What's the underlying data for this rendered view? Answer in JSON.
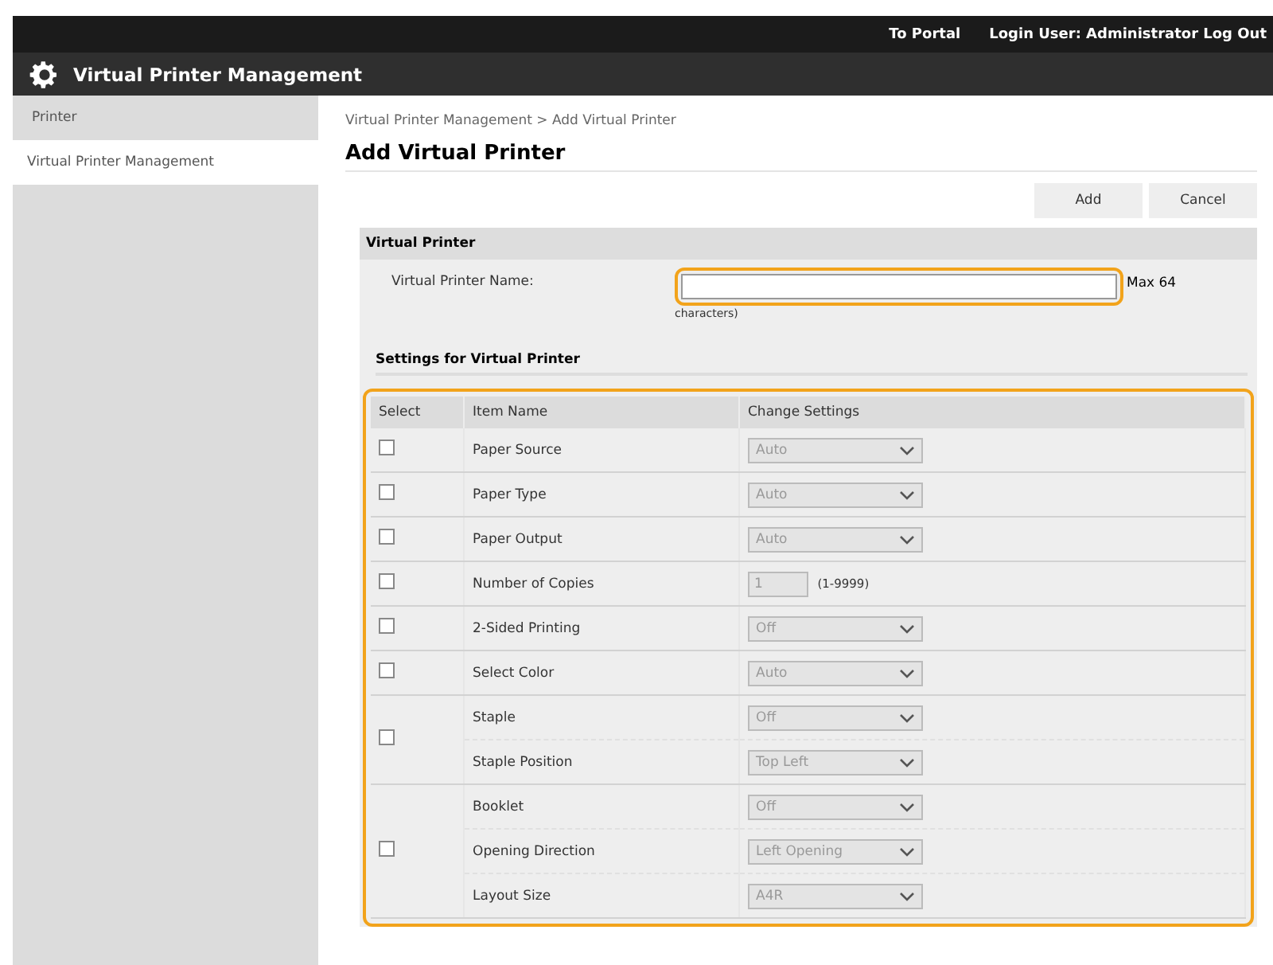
{
  "top_bar": {
    "links": [
      "To Portal",
      "Login User: Administrator Log Out"
    ]
  },
  "header": {
    "title": "Virtual Printer Management"
  },
  "sidebar": {
    "items": [
      {
        "label": "Printer",
        "selected": false
      },
      {
        "label": "Virtual Printer Management",
        "selected": true
      }
    ]
  },
  "breadcrumb": "Virtual Printer Management > Add Virtual Printer",
  "page_title": "Add Virtual Printer",
  "buttons": [
    "Add",
    "Cancel"
  ],
  "section": {
    "title": "Virtual Printer",
    "field_label": "Virtual Printer Name:",
    "hint": [
      "Max 64",
      "characters)"
    ]
  },
  "settings": {
    "title": "Settings for Virtual Printer",
    "columns": [
      "Select",
      "Item Name",
      "Change Settings"
    ],
    "groups": [
      {
        "checked": false,
        "items": [
          {
            "name": "Paper Source",
            "kind": "select",
            "value": "Auto",
            "disabled": true
          }
        ]
      },
      {
        "checked": false,
        "items": [
          {
            "name": "Paper Type",
            "kind": "select",
            "value": "Auto",
            "disabled": true
          }
        ]
      },
      {
        "checked": false,
        "items": [
          {
            "name": "Paper Output",
            "kind": "select",
            "value": "Auto",
            "disabled": true
          }
        ]
      },
      {
        "checked": false,
        "items": [
          {
            "name": "Number of Copies",
            "kind": "number",
            "value": "1",
            "note": "(1-9999)",
            "disabled": true
          }
        ]
      },
      {
        "checked": false,
        "items": [
          {
            "name": "2-Sided Printing",
            "kind": "select",
            "value": "Off",
            "disabled": true
          }
        ]
      },
      {
        "checked": false,
        "items": [
          {
            "name": "Select Color",
            "kind": "select",
            "value": "Auto",
            "disabled": true
          }
        ]
      },
      {
        "checked": false,
        "items": [
          {
            "name": "Staple",
            "kind": "select",
            "value": "Off",
            "disabled": true
          },
          {
            "name": "Staple Position",
            "kind": "select",
            "value": "Top Left",
            "disabled": true
          }
        ]
      },
      {
        "checked": false,
        "items": [
          {
            "name": "Booklet",
            "kind": "select",
            "value": "Off",
            "disabled": true
          },
          {
            "name": "Opening Direction",
            "kind": "select",
            "value": "Left Opening",
            "disabled": true
          },
          {
            "name": "Layout Size",
            "kind": "select",
            "value": "A4R",
            "disabled": true
          }
        ]
      }
    ]
  }
}
